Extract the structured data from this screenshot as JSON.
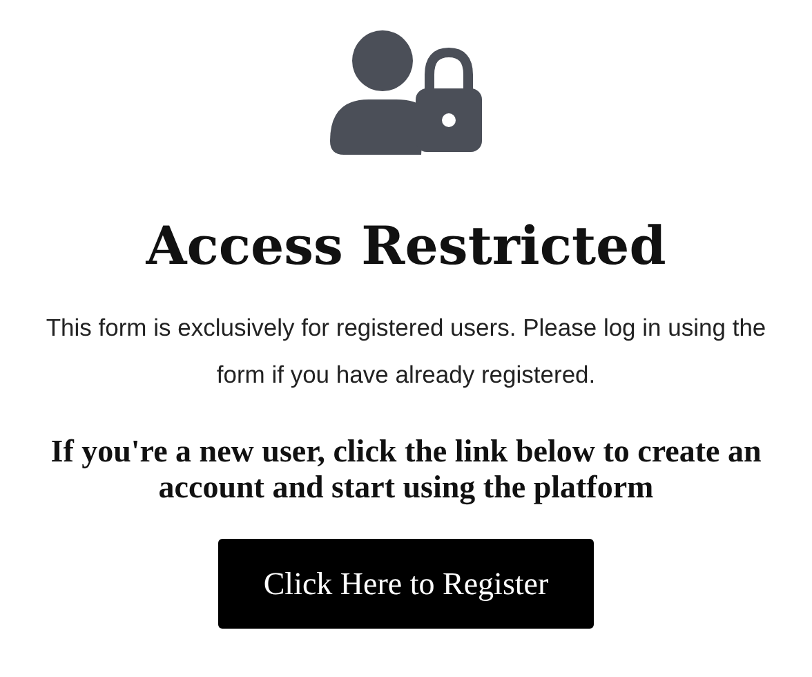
{
  "heading": "Access Restricted",
  "message": "This form is exclusively for registered users. Please log in using the form if you have already registered.",
  "subheading": "If you're a new user, click the link below to create an account and start using the platform",
  "button": {
    "label": "Click Here to Register"
  }
}
